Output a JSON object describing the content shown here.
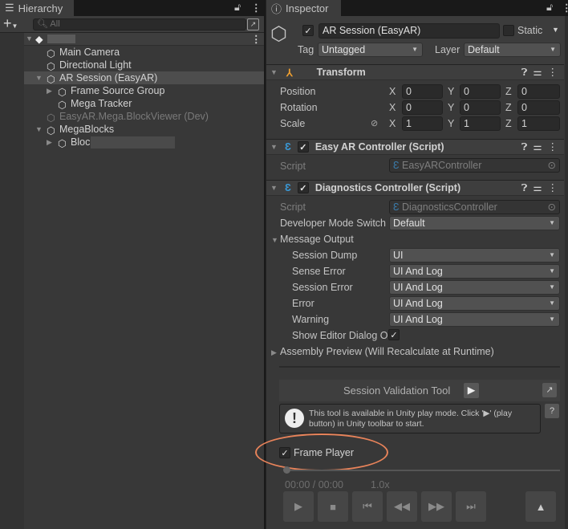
{
  "hierarchy": {
    "tab": "Hierarchy",
    "search_placeholder": "All",
    "items": [
      "Main Camera",
      "Directional Light",
      "AR Session (EasyAR)",
      "Frame Source Group",
      "Mega Tracker",
      "EasyAR.Mega.BlockViewer (Dev)",
      "MegaBlocks",
      "Bloc"
    ]
  },
  "inspector": {
    "tab": "Inspector",
    "object_name": "AR Session (EasyAR)",
    "static_label": "Static",
    "tag_label": "Tag",
    "tag_value": "Untagged",
    "layer_label": "Layer",
    "layer_value": "Default",
    "transform": {
      "title": "Transform",
      "rows": [
        {
          "label": "Position",
          "x": "0",
          "y": "0",
          "z": "0"
        },
        {
          "label": "Rotation",
          "x": "0",
          "y": "0",
          "z": "0"
        },
        {
          "label": "Scale",
          "x": "1",
          "y": "1",
          "z": "1"
        }
      ],
      "axis_x": "X",
      "axis_y": "Y",
      "axis_z": "Z"
    },
    "easyar": {
      "title": "Easy AR Controller (Script)",
      "script_label": "Script",
      "script_value": "EasyARController"
    },
    "diag": {
      "title": "Diagnostics Controller (Script)",
      "script_label": "Script",
      "script_value": "DiagnosticsController",
      "dev_label": "Developer Mode Switch",
      "dev_value": "Default",
      "msg_label": "Message Output",
      "msg_rows": [
        {
          "label": "Session Dump",
          "value": "UI"
        },
        {
          "label": "Sense Error",
          "value": "UI And Log"
        },
        {
          "label": "Session Error",
          "value": "UI And Log"
        },
        {
          "label": "Error",
          "value": "UI And Log"
        },
        {
          "label": "Warning",
          "value": "UI And Log"
        }
      ],
      "show_editor": "Show Editor Dialog O",
      "assembly": "Assembly Preview (Will Recalculate at Runtime)"
    },
    "tool": {
      "title": "Session Validation Tool",
      "info": "This tool is available in Unity play mode. Click '▶' (play button) in Unity toolbar to start.",
      "help": "?"
    },
    "player": {
      "label": "Frame Player",
      "time": "00:00 / 00:00",
      "speed": "1.0x",
      "progress": 0
    }
  }
}
